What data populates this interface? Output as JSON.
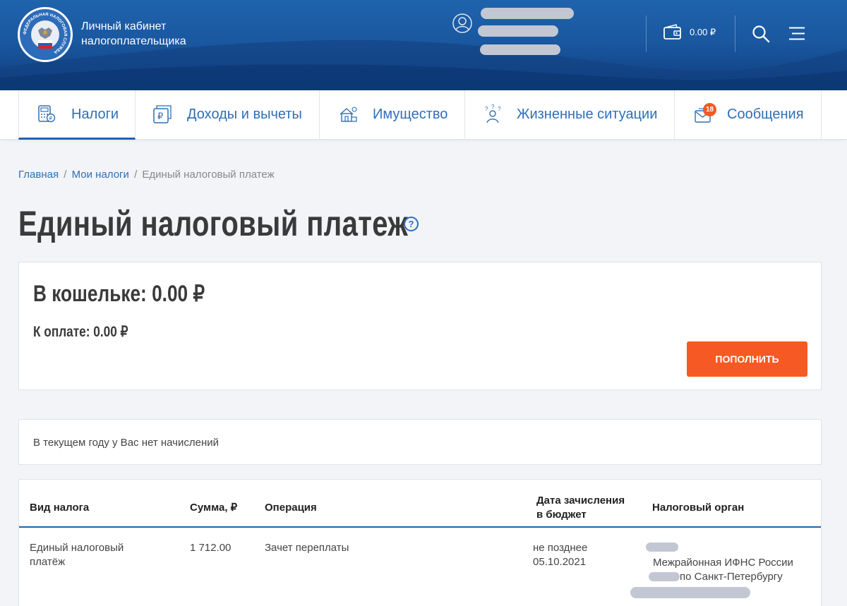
{
  "header": {
    "brand_line1": "Личный кабинет",
    "brand_line2": "налогоплательщика",
    "wallet_amount": "0.00 ₽",
    "logo_ring_text": "ФЕДЕРАЛЬНАЯ НАЛОГОВАЯ СЛУЖБА"
  },
  "nav": {
    "items": [
      {
        "label": "Налоги",
        "icon": "taxes-calculator-icon"
      },
      {
        "label": "Доходы и вычеты",
        "icon": "income-ruble-icon"
      },
      {
        "label": "Имущество",
        "icon": "property-house-icon"
      },
      {
        "label": "Жизненные ситуации",
        "icon": "life-situations-person-icon"
      },
      {
        "label": "Сообщения",
        "icon": "messages-envelope-icon"
      }
    ],
    "messages_badge": "18"
  },
  "breadcrumb": {
    "home": "Главная",
    "sep1": "/",
    "my_taxes": "Мои налоги",
    "sep2": "/",
    "current": "Единый налоговый платеж"
  },
  "page": {
    "title": "Единый налоговый платеж",
    "help_symbol": "?"
  },
  "wallet_card": {
    "title": "В кошельке: 0.00 ₽",
    "to_pay": "К оплате: 0.00 ₽",
    "button": "ПОПОЛНИТЬ"
  },
  "info": {
    "text": "В текущем году у Вас нет начислений"
  },
  "table": {
    "headers": {
      "tax_type": "Вид налога",
      "amount": "Сумма, ₽",
      "operation": "Операция",
      "date_line1": "Дата зачисления",
      "date_line2": "в бюджет",
      "authority": "Налоговый орган"
    },
    "rows": [
      {
        "tax_type_line1": "Единый налоговый",
        "tax_type_line2": "платёж",
        "amount": "1 712.00",
        "operation": "Зачет переплаты",
        "date_line1": "не позднее",
        "date_line2": "05.10.2021",
        "authority_line1": "Межрайонная ИФНС России",
        "authority_line2": "по Санкт-Петербургу"
      }
    ]
  },
  "colors": {
    "header_blue": "#1a58a0",
    "link_blue": "#2e6fb7",
    "accent_orange": "#f65923"
  }
}
